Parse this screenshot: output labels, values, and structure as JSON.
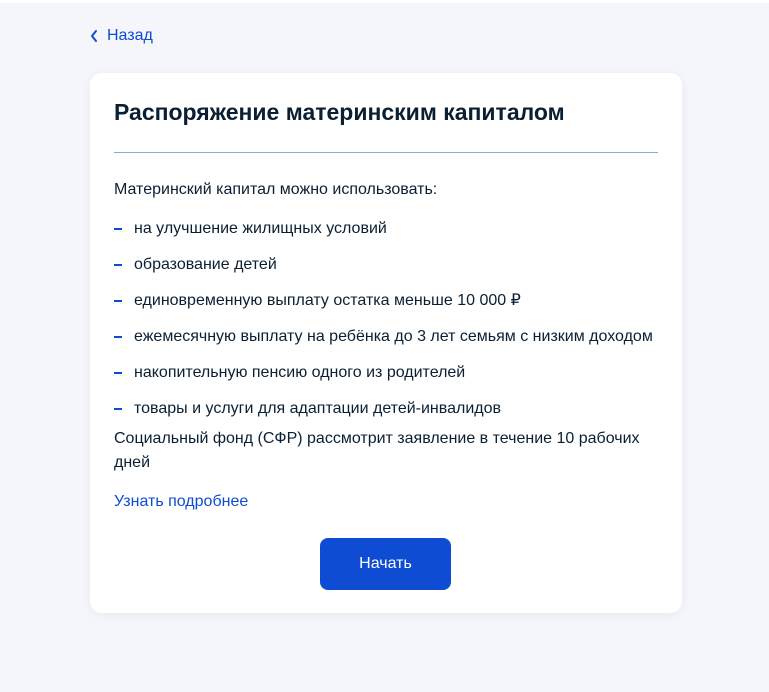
{
  "nav": {
    "back_label": "Назад"
  },
  "card": {
    "title": "Распоряжение материнским капиталом",
    "intro": "Материнский капитал можно использовать:",
    "items": [
      "на улучшение жилищных условий",
      "образование детей",
      "единовременную выплату остатка меньше 10 000 ₽",
      "ежемесячную выплату на ребёнка до 3 лет семьям с низким доходом",
      "накопительную пенсию одного из родителей",
      "товары и услуги для адаптации детей-инвалидов"
    ],
    "note": "Социальный фонд (СФР) рассмотрит заявление в течение 10 рабочих дней",
    "more_link": "Узнать подробнее",
    "start_button": "Начать"
  },
  "icons": {
    "back": "chevron-left-icon",
    "bullet": "dash-bullet"
  },
  "colors": {
    "accent": "#0d4cd3",
    "text": "#0b1f33",
    "background": "#f4f6fb",
    "card": "#ffffff",
    "divider": "#8ea9d6"
  }
}
